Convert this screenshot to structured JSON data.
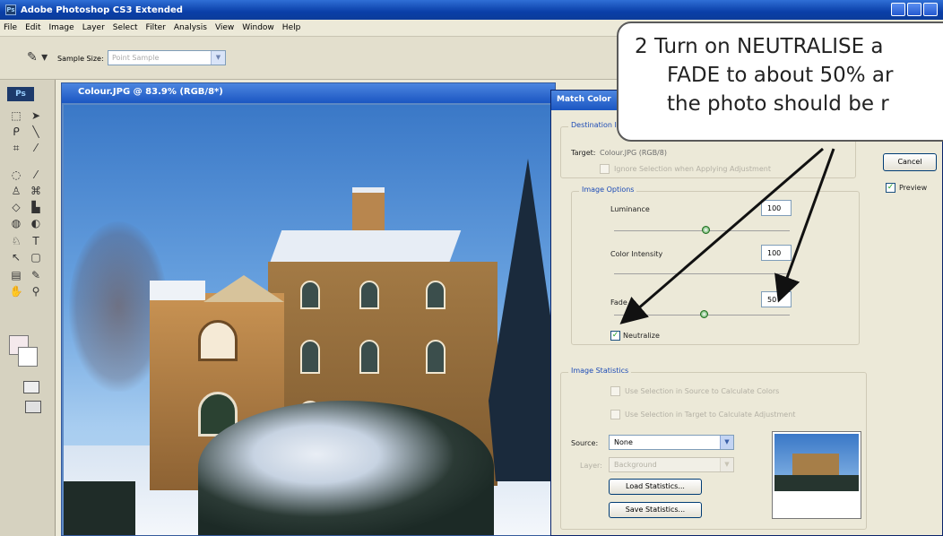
{
  "app": {
    "title": "Adobe Photoshop CS3 Extended",
    "logo": "Ps",
    "window_buttons": [
      "minimize-icon",
      "maximize-icon",
      "close-icon"
    ]
  },
  "menu": [
    "File",
    "Edit",
    "Image",
    "Layer",
    "Select",
    "Filter",
    "Analysis",
    "View",
    "Window",
    "Help"
  ],
  "options_bar": {
    "tool_icon": "eyedropper-icon",
    "sample_size_label": "Sample Size:",
    "sample_size_value": "Point Sample"
  },
  "document": {
    "title": "Colour.JPG @ 83.9% (RGB/8*)"
  },
  "dialog": {
    "title": "Match Color",
    "destination_group": "Destination Image",
    "target_label": "Target:",
    "target_value": "Colour.JPG (RGB/8)",
    "ignore_selection": "Ignore Selection when Applying Adjustment",
    "cancel_button": "Cancel",
    "preview_label": "Preview",
    "image_options_group": "Image Options",
    "luminance_label": "Luminance",
    "luminance_value": "100",
    "color_intensity_label": "Color Intensity",
    "color_intensity_value": "100",
    "fade_label": "Fade",
    "fade_value": "50",
    "neutralize_label": "Neutralize",
    "image_statistics_group": "Image Statistics",
    "use_selection_source": "Use Selection in Source to Calculate Colors",
    "use_selection_target": "Use Selection in Target to Calculate Adjustment",
    "source_label": "Source:",
    "source_value": "None",
    "layer_label": "Layer:",
    "layer_value": "Background",
    "load_statistics_button": "Load Statistics...",
    "save_statistics_button": "Save Statistics..."
  },
  "callout": {
    "line1": "2 Turn on NEUTRALISE a",
    "line2": "FADE to about 50% ar",
    "line3": "the photo should be r"
  },
  "colors": {
    "title_bar": "#0a3fa8",
    "dialog_bg": "#ece9d8",
    "group_label": "#1c4bb6",
    "check_green": "#21a121"
  }
}
